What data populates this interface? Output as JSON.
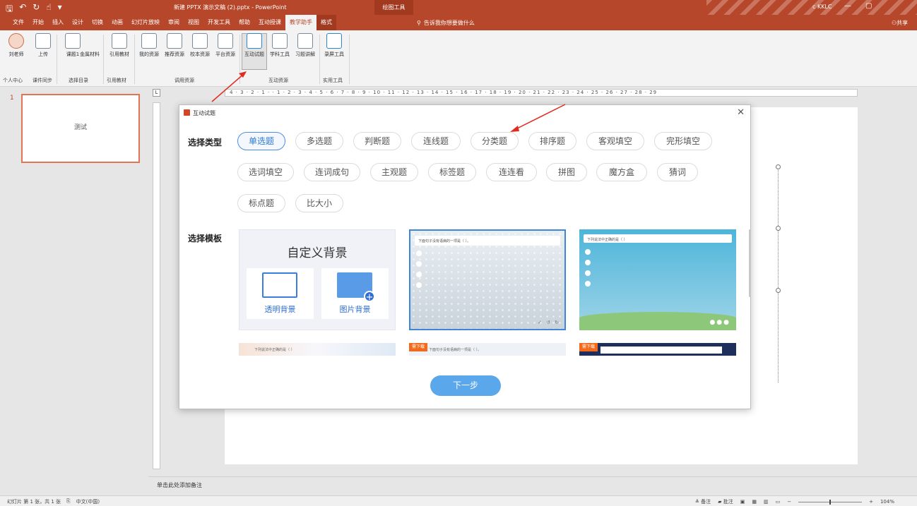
{
  "titlebar": {
    "qat_icons": [
      "save-icon",
      "undo-icon",
      "redo-icon",
      "touch-mode-icon",
      "customize-icon"
    ],
    "doc_title": "新建 PPTX 演示文稿 (2).pptx  -  PowerPoint",
    "context_title": "绘图工具",
    "account": "c KKLC",
    "colors": {
      "accent": "#b7472a",
      "context": "#a23a20"
    }
  },
  "menu": {
    "tabs": [
      "文件",
      "开始",
      "插入",
      "设计",
      "切换",
      "动画",
      "幻灯片放映",
      "审阅",
      "视图",
      "开发工具",
      "帮助",
      "互动授课",
      "教学助手",
      "格式"
    ],
    "active_tab": "教学助手",
    "tell_me": "告诉我你想要做什么",
    "share": "共享"
  },
  "ribbon": {
    "buttons": [
      "刘老师",
      "上传",
      "课题1",
      "金属材料",
      "引用教材",
      "我的资源",
      "推荐资源",
      "校本资源",
      "平台资源",
      "互动试题",
      "学科工具",
      "习题讲解",
      "录屏工具"
    ],
    "groups": [
      "个人中心",
      "课件同步",
      "选择目录",
      "引用教材",
      "调用资源",
      "互动资源",
      "实用工具"
    ]
  },
  "slides_pane": {
    "number": "1",
    "thumb_text": "测试"
  },
  "ruler": {
    "corner": "L",
    "labels": "4 · 3 · 2 · 1 ·  · 1 · 2 · 3 · 4 · 5 · 6 · 7 · 8 · 9 · 10 · 11 · 12 · 13 · 14 · 15 · 16 · 17 · 18 · 19 · 20 · 21 · 22 · 23 · 24 · 25 · 26 · 27 · 28 · 29"
  },
  "notes_placeholder": "单击此处添加备注",
  "status": {
    "slide_info": "幻灯片 第 1 张，共 1 张",
    "language": "中文(中国)",
    "notes": "备注",
    "comments": "批注",
    "zoom": "104%"
  },
  "dialog": {
    "title": "互动试题",
    "type_label": "选择类型",
    "template_label": "选择模板",
    "types": [
      "单选题",
      "多选题",
      "判断题",
      "连线题",
      "分类题",
      "排序题",
      "客观填空",
      "完形填空",
      "选词填空",
      "连词成句",
      "主观题",
      "标签题",
      "连连看",
      "拼图",
      "魔方盒",
      "猜词",
      "标点题",
      "比大小"
    ],
    "selected_type": "单选题",
    "custom_bg": {
      "heading": "自定义背景",
      "options": [
        "透明背景",
        "图片背景"
      ]
    },
    "template_question": "下面句子没有语病的一项是（ ）。",
    "template2_question": "下列说法中正确的是（ ）",
    "template2_options": [
      "",
      "",
      "",
      ""
    ],
    "template_preview_text": "下列说法中正确的是（ ）",
    "need_download": "需下载",
    "next": "下一步",
    "colors": {
      "primary": "#5aa7ec",
      "selected": "#2a7be0",
      "download": "#f26b1d"
    }
  }
}
